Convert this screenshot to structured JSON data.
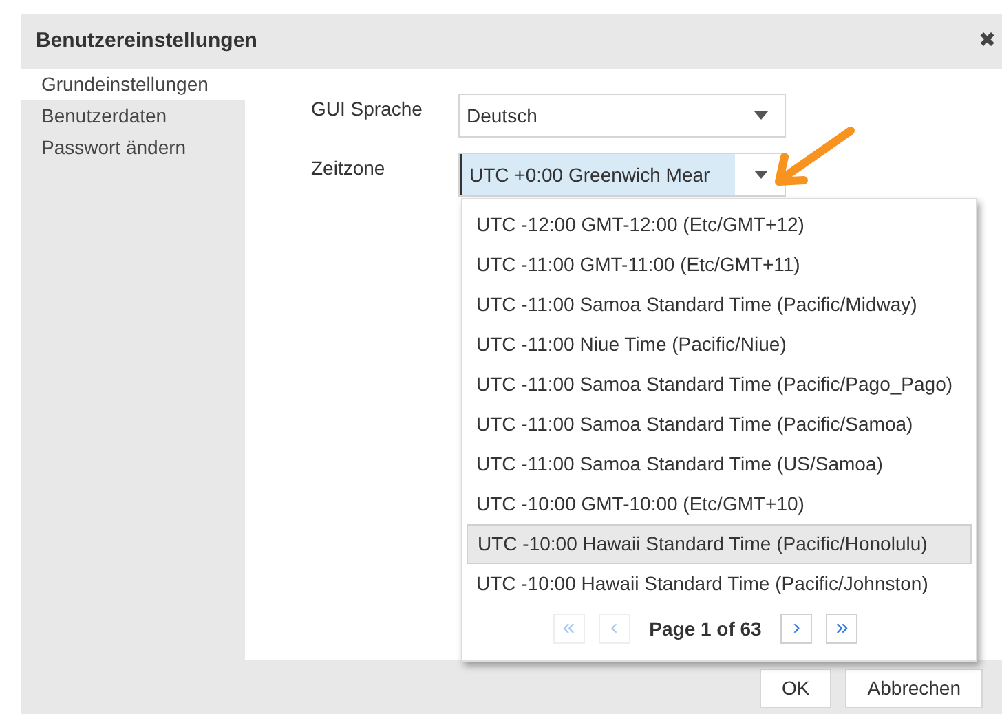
{
  "window": {
    "title": "Benutzereinstellungen",
    "close": "✖"
  },
  "sidebar": {
    "items": [
      {
        "label": "Grundeinstellungen",
        "selected": true
      },
      {
        "label": "Benutzerdaten",
        "selected": false
      },
      {
        "label": "Passwort ändern",
        "selected": false
      }
    ]
  },
  "form": {
    "fields": [
      {
        "label": "GUI Sprache",
        "value": "Deutsch",
        "focused": false
      },
      {
        "label": "Zeitzone",
        "value": "UTC +0:00 Greenwich Mear",
        "focused": true
      }
    ]
  },
  "dropdown": {
    "options": [
      {
        "label": "UTC -12:00 GMT-12:00 (Etc/GMT+12)",
        "selected": false
      },
      {
        "label": "UTC -11:00 GMT-11:00 (Etc/GMT+11)",
        "selected": false
      },
      {
        "label": "UTC -11:00 Samoa Standard Time (Pacific/Midway)",
        "selected": false
      },
      {
        "label": "UTC -11:00 Niue Time (Pacific/Niue)",
        "selected": false
      },
      {
        "label": "UTC -11:00 Samoa Standard Time (Pacific/Pago_Pago)",
        "selected": false
      },
      {
        "label": "UTC -11:00 Samoa Standard Time (Pacific/Samoa)",
        "selected": false
      },
      {
        "label": "UTC -11:00 Samoa Standard Time (US/Samoa)",
        "selected": false
      },
      {
        "label": "UTC -10:00 GMT-10:00 (Etc/GMT+10)",
        "selected": false
      },
      {
        "label": "UTC -10:00 Hawaii Standard Time (Pacific/Honolulu)",
        "selected": true
      },
      {
        "label": "UTC -10:00 Hawaii Standard Time (Pacific/Johnston)",
        "selected": false
      }
    ],
    "pager": {
      "first": "«",
      "prev": "‹",
      "page": "Page 1 of 63",
      "next": "›",
      "last": "»",
      "first_disabled": true,
      "prev_disabled": true
    }
  },
  "buttons": [
    "OK",
    "Abbrechen"
  ]
}
